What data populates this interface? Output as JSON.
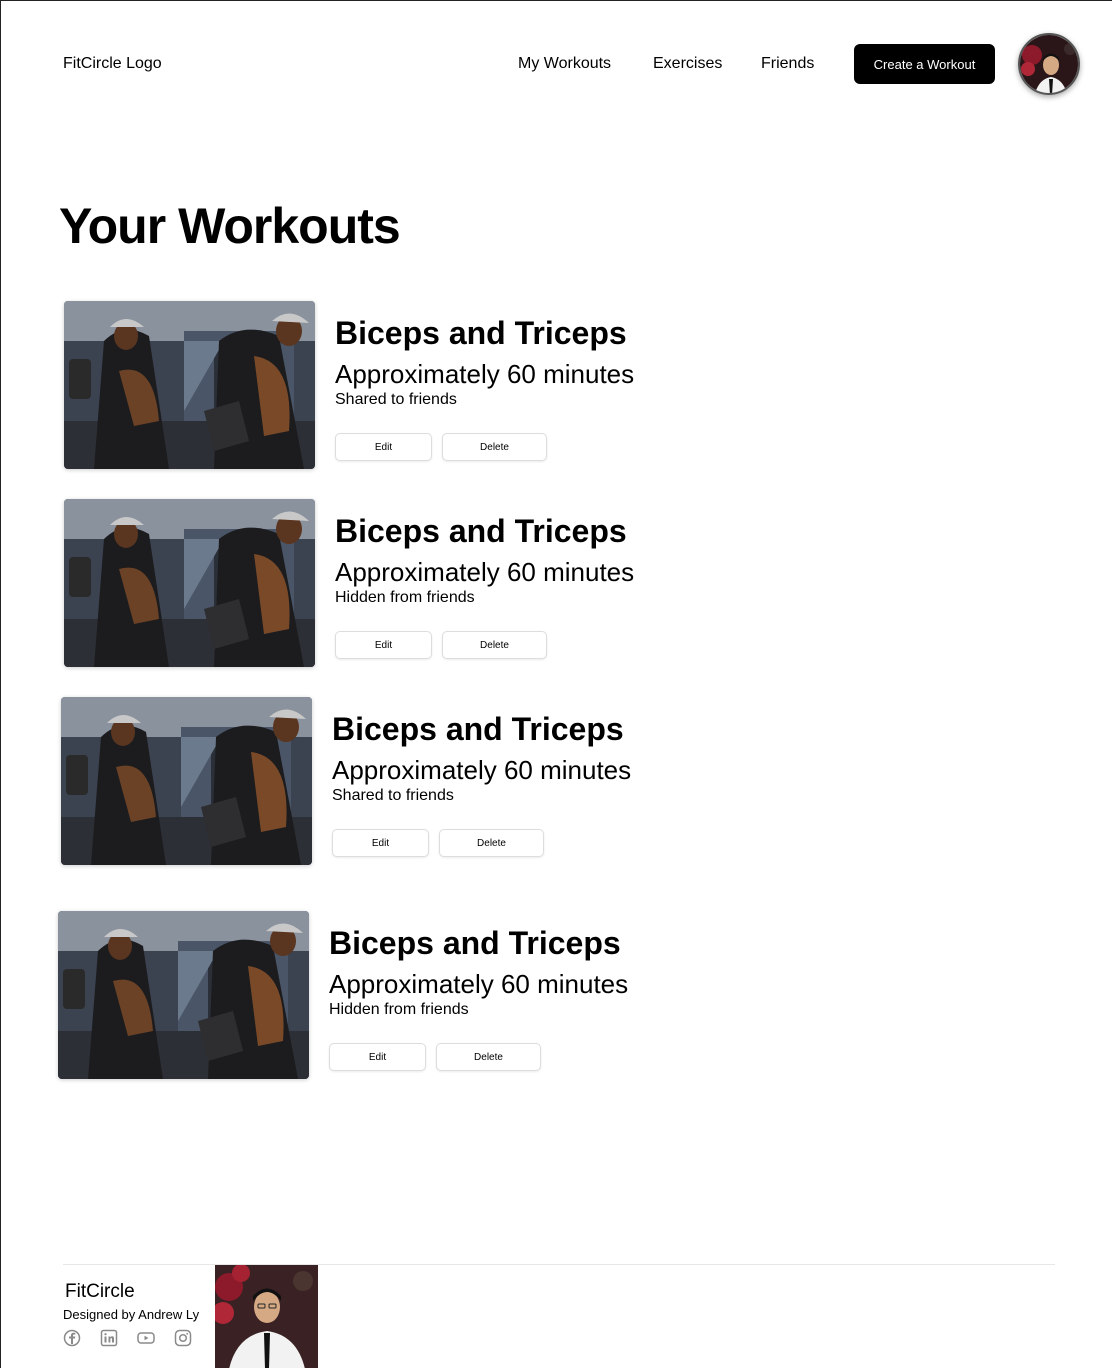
{
  "header": {
    "logo": "FitCircle Logo",
    "nav": [
      "My Workouts",
      "Exercises",
      "Friends"
    ],
    "cta": "Create a Workout"
  },
  "main": {
    "title": "Your Workouts",
    "workouts": [
      {
        "title": "Biceps and Triceps",
        "duration": "Approximately 60 minutes",
        "visibility": "Shared to friends",
        "edit": "Edit",
        "delete": "Delete"
      },
      {
        "title": "Biceps and Triceps",
        "duration": "Approximately 60 minutes",
        "visibility": "Hidden from friends",
        "edit": "Edit",
        "delete": "Delete"
      },
      {
        "title": "Biceps and Triceps",
        "duration": "Approximately 60 minutes",
        "visibility": "Shared to friends",
        "edit": "Edit",
        "delete": "Delete"
      },
      {
        "title": "Biceps and Triceps",
        "duration": "Approximately 60 minutes",
        "visibility": "Hidden from friends",
        "edit": "Edit",
        "delete": "Delete"
      }
    ]
  },
  "footer": {
    "brand": "FitCircle",
    "credit": "Designed by Andrew Ly",
    "social_icons": [
      "facebook-icon",
      "linkedin-icon",
      "youtube-icon",
      "instagram-icon"
    ]
  },
  "colors": {
    "primary": "#000000",
    "background": "#ffffff",
    "icon_gray": "#8a8a8a"
  }
}
